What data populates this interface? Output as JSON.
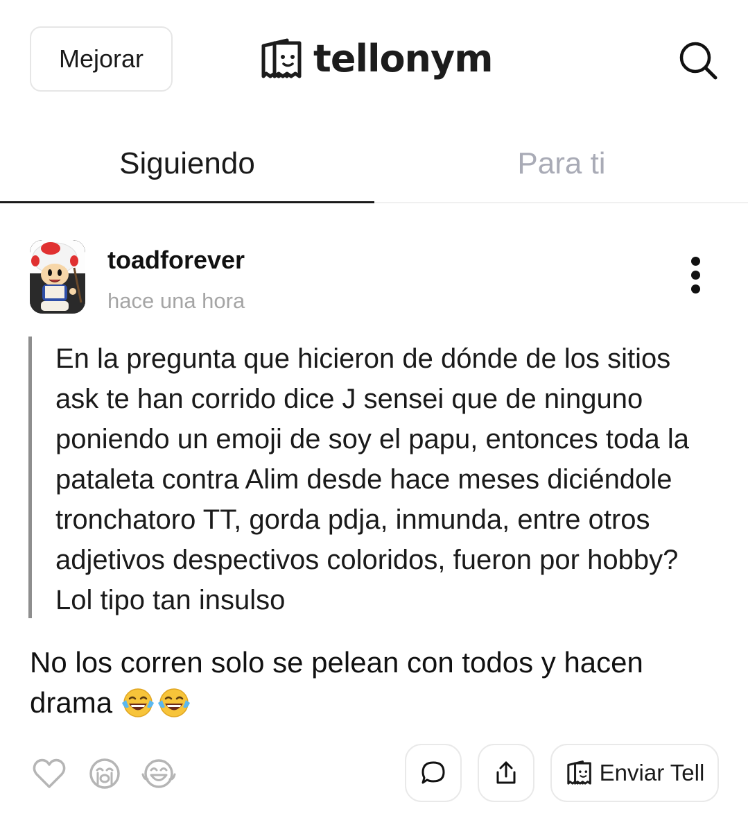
{
  "header": {
    "upgrade_label": "Mejorar",
    "logo_text": "tellonym",
    "logo_icon": "tellonym-logo-icon",
    "search_icon": "search-icon"
  },
  "tabs": [
    {
      "label": "Siguiendo",
      "active": true
    },
    {
      "label": "Para ti",
      "active": false
    }
  ],
  "post": {
    "username": "toadforever",
    "timestamp": "hace una hora",
    "more_icon": "more-vertical-icon",
    "question": "En la pregunta que hicieron de dónde de los sitios ask te han corrido dice J sensei que de ninguno poniendo un emoji de soy el papu, entonces toda la pataleta contra Alim desde hace meses diciéndole tronchatoro TT, gorda pdja, inmunda, entre otros adjetivos despectivos coloridos, fueron por hobby? Lol tipo tan insulso",
    "answer": "No los corren solo se pelean con todos y hacen drama",
    "answer_emojis": "😂😂"
  },
  "actions": {
    "reactions": [
      "heart-icon",
      "crying-face-icon",
      "laughing-face-icon"
    ],
    "comment_icon": "comment-icon",
    "share_icon": "share-icon",
    "send_tell_label": "Enviar Tell"
  },
  "colors": {
    "text": "#111111",
    "muted": "#a5a5a5",
    "tab_inactive": "#a9abb6",
    "border": "#e6e6e6",
    "quote_bar": "#8e8e8e"
  }
}
